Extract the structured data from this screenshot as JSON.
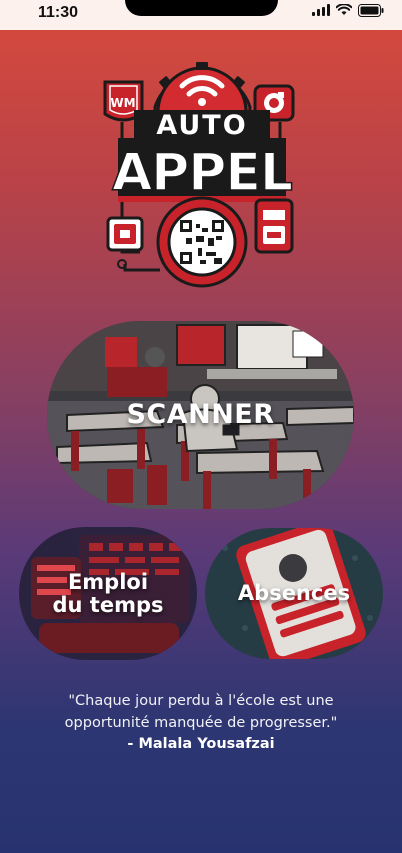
{
  "status_bar": {
    "time": "11:30",
    "icons": [
      "signal-icon",
      "wifi-icon",
      "battery-icon"
    ]
  },
  "logo": {
    "line1": "AUTO",
    "line2": "APPEL",
    "badge": "WM"
  },
  "tiles": {
    "scanner": {
      "label": "SCANNER"
    },
    "emploi": {
      "label_line1": "Emploi",
      "label_line2": "du temps"
    },
    "absences": {
      "label": "Absences"
    }
  },
  "quote": {
    "line1": "\"Chaque jour perdu à l'école est une",
    "line2": "opportunité manquée de progresser.\"",
    "author": "- Malala Yousafzai"
  },
  "colors": {
    "gradient_top": "#d84a3c",
    "gradient_bottom": "#273370",
    "accent_red": "#c8222a"
  }
}
